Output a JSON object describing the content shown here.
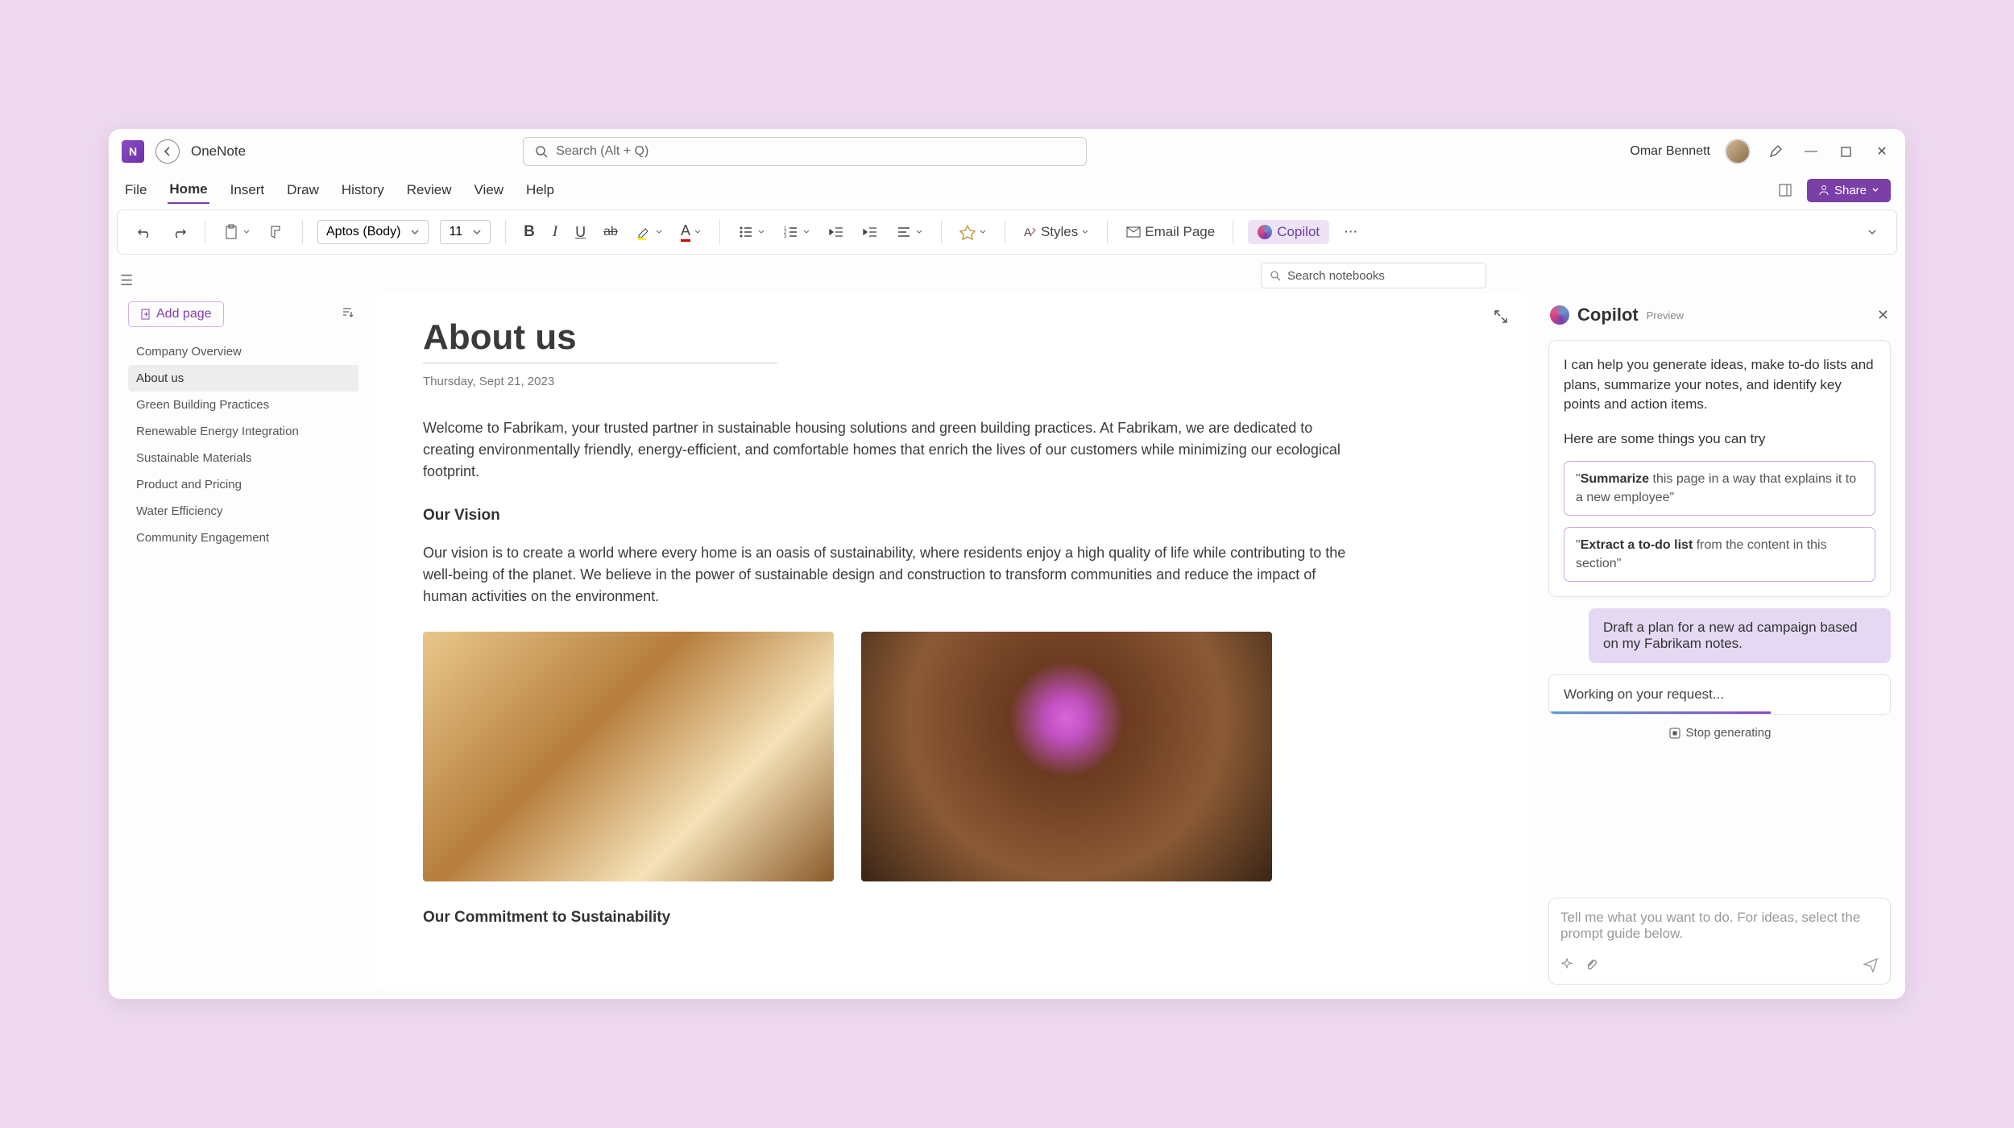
{
  "titlebar": {
    "app_name": "OneNote",
    "search_placeholder": "Search (Alt + Q)",
    "user_name": "Omar Bennett"
  },
  "menubar": {
    "items": [
      "File",
      "Home",
      "Insert",
      "Draw",
      "History",
      "Review",
      "View",
      "Help"
    ],
    "active_index": 1,
    "share_label": "Share"
  },
  "ribbon": {
    "font_name": "Aptos (Body)",
    "font_size": "11",
    "styles_label": "Styles",
    "email_label": "Email Page",
    "copilot_label": "Copilot"
  },
  "search_notebooks_placeholder": "Search notebooks",
  "sidebar": {
    "add_page_label": "Add page",
    "pages": [
      "Company Overview",
      "About us",
      "Green Building Practices",
      "Renewable Energy Integration",
      "Sustainable Materials",
      "Product and Pricing",
      "Water Efficiency",
      "Community Engagement"
    ],
    "active_index": 1
  },
  "content": {
    "title": "About us",
    "date": "Thursday, Sept 21, 2023",
    "intro": "Welcome to Fabrikam, your trusted partner in sustainable housing solutions and green building practices. At Fabrikam, we are dedicated to creating environmentally friendly, energy-efficient, and comfortable homes that enrich the lives of our customers while minimizing our ecological footprint.",
    "vision_head": "Our Vision",
    "vision_body": "Our vision is to create a world where every home is an oasis of sustainability, where residents enjoy a high quality of life while contributing to the well-being of the planet. We believe in the power of sustainable design and construction to transform communities and reduce the impact of human activities on the environment.",
    "commitment_head": "Our Commitment to Sustainability"
  },
  "copilot": {
    "title": "Copilot",
    "preview": "Preview",
    "intro": "I can help you generate ideas, make to-do lists and plans, summarize your notes, and identify key points and action items.",
    "prompt_lead": "Here are some things you can try",
    "sugg1_bold": "Summarize",
    "sugg1_rest": " this page in a way that explains it to a new employee\"",
    "sugg2_bold": "Extract a to-do list",
    "sugg2_rest": " from the content in this section\"",
    "user_msg": "Draft a plan for a new ad campaign based on my Fabrikam notes.",
    "working": "Working on your request...",
    "stop_label": "Stop generating",
    "input_placeholder": "Tell me what you want to do. For ideas, select the prompt guide below."
  }
}
